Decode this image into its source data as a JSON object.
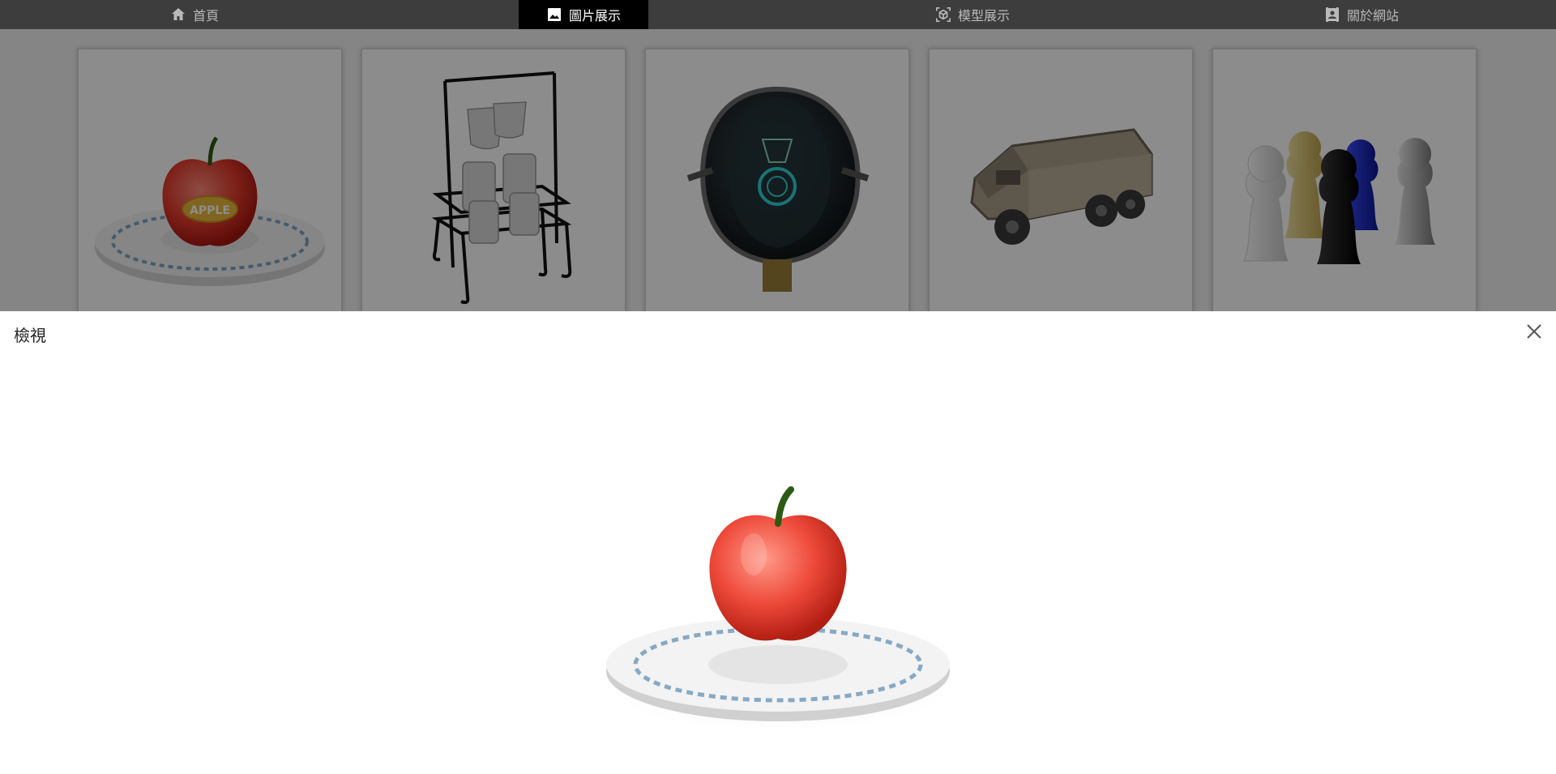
{
  "nav": {
    "items": [
      {
        "label": "首頁",
        "icon": "home-icon",
        "active": false
      },
      {
        "label": "圖片展示",
        "icon": "image-icon",
        "active": true
      },
      {
        "label": "模型展示",
        "icon": "3d-model-icon",
        "active": false
      },
      {
        "label": "關於網站",
        "icon": "contact-card-icon",
        "active": false
      }
    ]
  },
  "gallery": {
    "items": [
      {
        "subject": "apple-on-plate",
        "badge": "APPLE"
      },
      {
        "subject": "mug-rack"
      },
      {
        "subject": "helmet"
      },
      {
        "subject": "armored-truck"
      },
      {
        "subject": "chess-pawns"
      }
    ]
  },
  "dialog": {
    "title": "檢視",
    "close_icon": "close-icon",
    "viewer_subject": "apple-on-plate"
  }
}
